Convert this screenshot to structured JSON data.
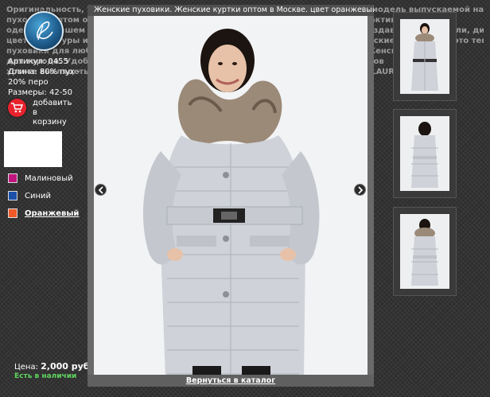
{
  "background_text": [
    "Оригинальность, уникальность и неповторимость — вот что отличает каждую модель выпускаемой нами продукции. Женские",
    "пуховики оптом от LAURA — это стиль и качество. Куртки для прогулок и для активного отдыха",
    "одежда в нашем каталоге — яркие и стильные женские куртки и пуховики. Создавая свои модели, дизайнеры",
    "цвета, фактуры и детали кроя. Вы найдёте модели для любого возраста. Женские пуховики — это тепло и",
    "пуховики для любой погоды. Вы сможете подобрать модель на любой вкус. Женские пуховики",
    "для города. Удобная система заказа и доставки. Оптовые покупатели магазинов",
    "хотите выглядеть стильно и модно в любую погоду — выбирайте пуховики от LAURA."
  ],
  "product": {
    "article": "Артикул: 0455",
    "length": "Длина: 80% пух -",
    "fill": "20% перо",
    "sizes": "Размеры: 42-50"
  },
  "cart": {
    "label_lines": [
      "добавить",
      "в",
      "корзину"
    ],
    "icon": "cart-icon",
    "color": "#e8232e"
  },
  "colors": [
    {
      "label": "Малиновый",
      "hex": "#c0157e",
      "active": false
    },
    {
      "label": "Синий",
      "hex": "#1c4fa8",
      "active": false
    },
    {
      "label": "Оранжевый",
      "hex": "#f05a28",
      "active": true
    }
  ],
  "price": {
    "label": "Цена:",
    "value": "2,000 руб."
  },
  "stock": "Есть в наличии",
  "lightbox": {
    "title": "Женские пуховики. Женские куртки оптом в Москве. цвет оранжевый",
    "back_link": "Вернуться в каталог",
    "prev_icon": "chevron-left-icon",
    "next_icon": "chevron-right-icon"
  },
  "thumbnails": [
    "front",
    "back",
    "back-fur"
  ]
}
